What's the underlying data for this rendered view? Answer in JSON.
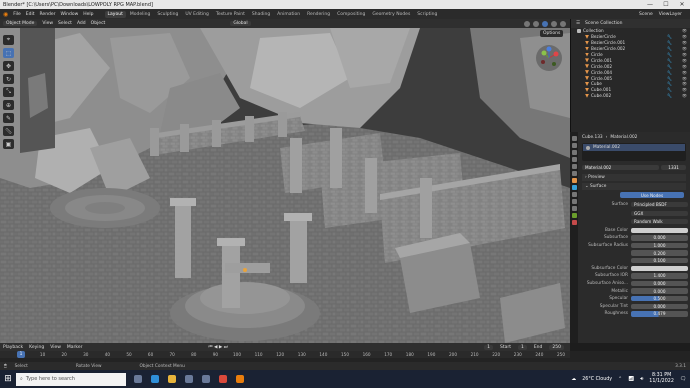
{
  "titlebar": {
    "title": "Blender* [C:\\Users\\PC\\Downloads\\LOWPOLY RPG MAP.blend]",
    "min": "—",
    "max": "☐",
    "close": "✕"
  },
  "menubar": {
    "items": [
      "File",
      "Edit",
      "Render",
      "Window",
      "Help"
    ],
    "workspaces": [
      "Layout",
      "Modeling",
      "Sculpting",
      "UV Editing",
      "Texture Paint",
      "Shading",
      "Animation",
      "Rendering",
      "Compositing",
      "Geometry Nodes",
      "Scripting"
    ],
    "scene": "Scene",
    "view_layer": "ViewLayer"
  },
  "viewport_header": {
    "mode": "Object Mode",
    "view": "View",
    "select": "Select",
    "add": "Add",
    "object": "Object",
    "orientation": "Global",
    "options": "Options"
  },
  "toolbar": {
    "icons": [
      "cursor-icon",
      "select-box-icon",
      "move-icon",
      "rotate-icon",
      "scale-icon",
      "transform-icon",
      "annotate-icon",
      "measure-icon",
      "add-cube-icon"
    ]
  },
  "outliner": {
    "title": "Scene Collection",
    "items": [
      {
        "name": "Collection",
        "type": "collection"
      },
      {
        "name": "BezierCircle",
        "type": "object"
      },
      {
        "name": "BezierCircle.001",
        "type": "object"
      },
      {
        "name": "BezierCircle.002",
        "type": "object"
      },
      {
        "name": "Circle",
        "type": "object"
      },
      {
        "name": "Circle.001",
        "type": "object"
      },
      {
        "name": "Circle.002",
        "type": "object"
      },
      {
        "name": "Circle.004",
        "type": "object"
      },
      {
        "name": "Circle.005",
        "type": "object"
      },
      {
        "name": "Cube",
        "type": "object"
      },
      {
        "name": "Cube.001",
        "type": "object"
      },
      {
        "name": "Cube.002",
        "type": "object"
      }
    ]
  },
  "properties": {
    "object": "Cube.133",
    "material_slot": "Material.002",
    "material_list": "Material.002",
    "material_field": "Material.002",
    "material_users": "1331",
    "sections": {
      "preview": "Preview",
      "surface": "Surface"
    },
    "use_nodes": "Use Nodes",
    "surface_label": "Surface",
    "surface_value": "Principled BSDF",
    "distribution": "GGX",
    "subsurface_method": "Random Walk",
    "fields": [
      {
        "label": "Base Color",
        "value": ""
      },
      {
        "label": "Subsurface",
        "value": "0.000"
      },
      {
        "label": "Subsurface Radius",
        "value": "1.000"
      },
      {
        "label": "",
        "value": "0.200"
      },
      {
        "label": "",
        "value": "0.100"
      },
      {
        "label": "Subsurface Color",
        "value": ""
      },
      {
        "label": "Subsurface IOR",
        "value": "1.400"
      },
      {
        "label": "Subsurface Aniso...",
        "value": "0.000"
      },
      {
        "label": "Metallic",
        "value": "0.000"
      },
      {
        "label": "Specular",
        "value": "0.500"
      },
      {
        "label": "Specular Tint",
        "value": "0.000"
      },
      {
        "label": "Roughness",
        "value": "0.479"
      }
    ]
  },
  "timeline": {
    "playback": "Playback",
    "keying": "Keying",
    "view": "View",
    "marker": "Marker",
    "current_frame": "1",
    "start_label": "Start",
    "start": "1",
    "end_label": "End",
    "end": "250",
    "ruler": [
      "1",
      "10",
      "20",
      "30",
      "40",
      "50",
      "60",
      "70",
      "80",
      "90",
      "100",
      "110",
      "120",
      "130",
      "140",
      "150",
      "160",
      "170",
      "180",
      "190",
      "200",
      "210",
      "220",
      "230",
      "240",
      "250"
    ]
  },
  "statusbar": {
    "select": "Select",
    "rotate": "Rotate View",
    "context": "Object Context Menu",
    "version": "3.3.1"
  },
  "taskbar": {
    "search_placeholder": "Type here to search",
    "weather": "26°C  Cloudy",
    "time": "8:31 PM",
    "date": "11/1/2022"
  },
  "colors": {
    "accent": "#4772b3",
    "object_icon": "#e4954a",
    "modifier": "#38a0d8"
  }
}
